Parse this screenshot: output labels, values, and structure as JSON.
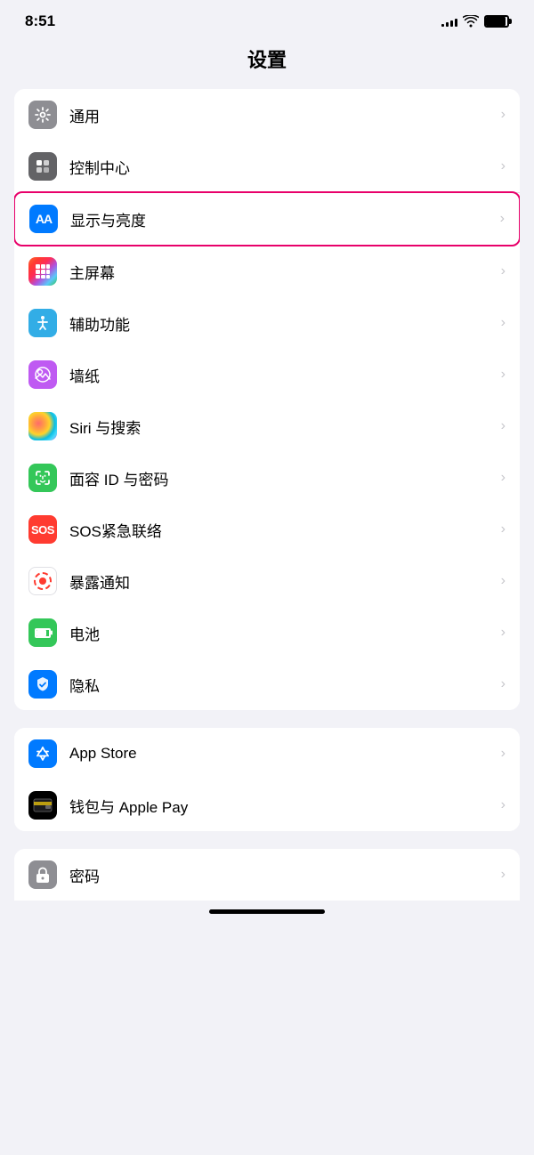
{
  "statusBar": {
    "time": "8:51",
    "signalBars": [
      3,
      5,
      7,
      9,
      11
    ],
    "wifi": "wifi",
    "battery": "battery"
  },
  "pageTitle": "设置",
  "groups": [
    {
      "id": "group1",
      "items": [
        {
          "id": "general",
          "label": "通用",
          "icon": "gear",
          "iconBg": "icon-gray",
          "highlighted": false
        },
        {
          "id": "control-center",
          "label": "控制中心",
          "icon": "control",
          "iconBg": "icon-gray2",
          "highlighted": false
        },
        {
          "id": "display",
          "label": "显示与亮度",
          "icon": "aa",
          "iconBg": "icon-blue",
          "highlighted": true
        },
        {
          "id": "homescreen",
          "label": "主屏幕",
          "icon": "grid",
          "iconBg": "icon-colorful",
          "highlighted": false
        },
        {
          "id": "accessibility",
          "label": "辅助功能",
          "icon": "accessibility",
          "iconBg": "icon-teal",
          "highlighted": false
        },
        {
          "id": "wallpaper",
          "label": "墙纸",
          "icon": "wallpaper",
          "iconBg": "icon-purple",
          "highlighted": false
        },
        {
          "id": "siri",
          "label": "Siri 与搜索",
          "icon": "siri",
          "iconBg": "icon-siri",
          "highlighted": false
        },
        {
          "id": "faceid",
          "label": "面容 ID 与密码",
          "icon": "faceid",
          "iconBg": "icon-green",
          "highlighted": false
        },
        {
          "id": "sos",
          "label": "SOS紧急联络",
          "icon": "sos",
          "iconBg": "icon-red",
          "highlighted": false
        },
        {
          "id": "exposure",
          "label": "暴露通知",
          "icon": "exposure",
          "iconBg": "icon-exposure",
          "highlighted": false
        },
        {
          "id": "battery",
          "label": "电池",
          "icon": "battery",
          "iconBg": "icon-battery",
          "highlighted": false
        },
        {
          "id": "privacy",
          "label": "隐私",
          "icon": "privacy",
          "iconBg": "icon-privacy",
          "highlighted": false
        }
      ]
    },
    {
      "id": "group2",
      "items": [
        {
          "id": "appstore",
          "label": "App Store",
          "icon": "appstore",
          "iconBg": "icon-appstore",
          "highlighted": false
        },
        {
          "id": "wallet",
          "label": "钱包与 Apple Pay",
          "icon": "wallet",
          "iconBg": "icon-wallet",
          "highlighted": false
        }
      ]
    },
    {
      "id": "group3",
      "items": [
        {
          "id": "password",
          "label": "密码",
          "icon": "password",
          "iconBg": "icon-password",
          "highlighted": false
        }
      ]
    }
  ]
}
